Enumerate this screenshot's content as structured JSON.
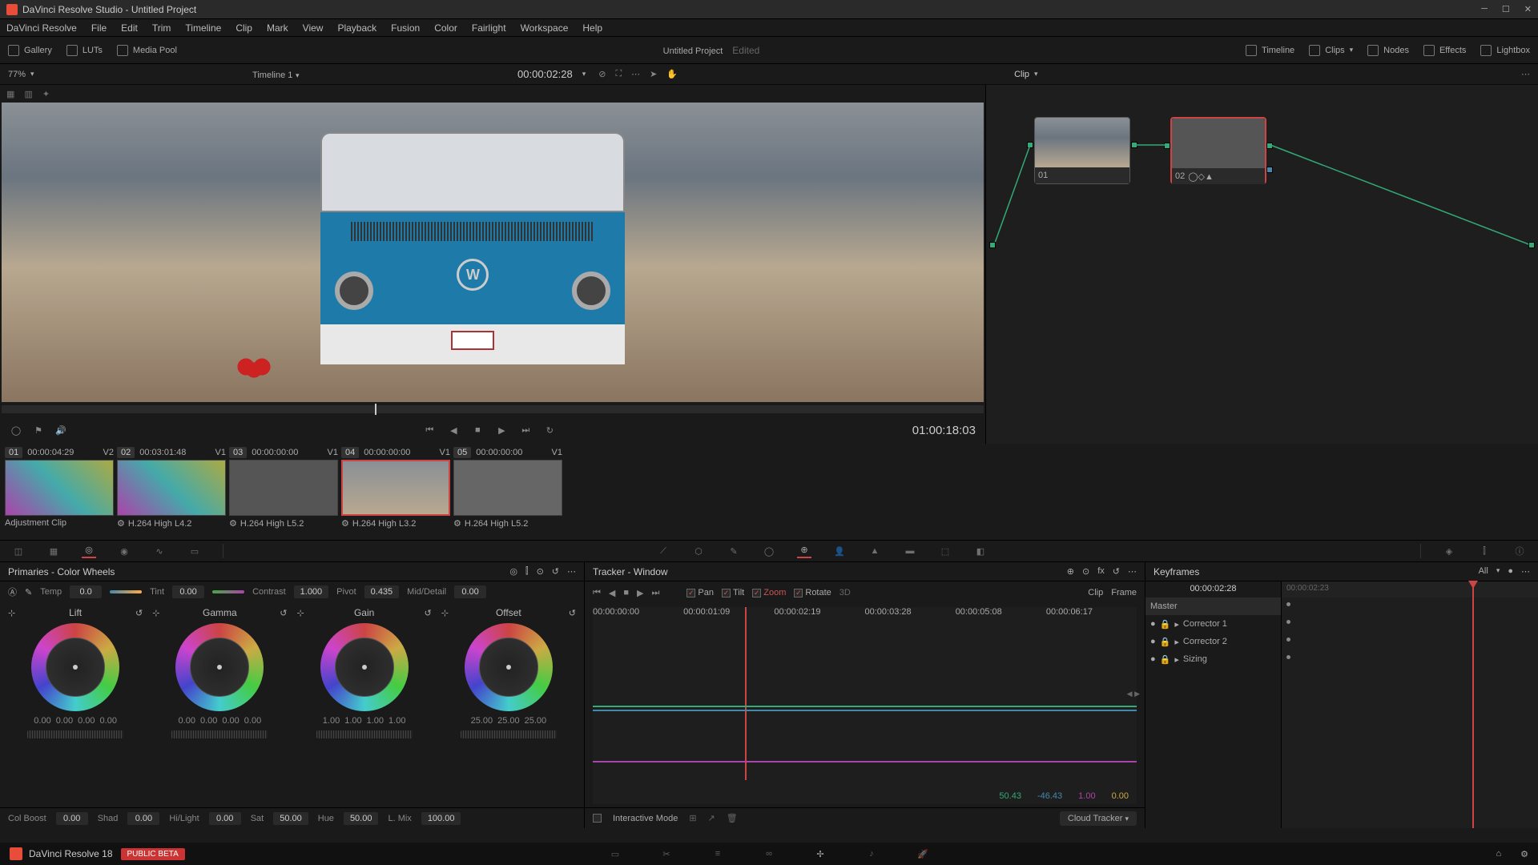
{
  "titlebar": {
    "title": "DaVinci Resolve Studio - Untitled Project"
  },
  "menubar": [
    "DaVinci Resolve",
    "File",
    "Edit",
    "Trim",
    "Timeline",
    "Clip",
    "Mark",
    "View",
    "Playback",
    "Fusion",
    "Color",
    "Fairlight",
    "Workspace",
    "Help"
  ],
  "workspace": {
    "left": [
      {
        "label": "Gallery"
      },
      {
        "label": "LUTs"
      },
      {
        "label": "Media Pool"
      }
    ],
    "project": "Untitled Project",
    "edited": "Edited",
    "right": [
      {
        "label": "Timeline"
      },
      {
        "label": "Clips"
      },
      {
        "label": "Nodes"
      },
      {
        "label": "Effects"
      },
      {
        "label": "Lightbox"
      }
    ]
  },
  "viewerbar": {
    "zoom": "77%",
    "timeline": "Timeline 1",
    "tc": "00:00:02:28",
    "mode": "Clip"
  },
  "transport": {
    "tc": "01:00:18:03"
  },
  "nodes": {
    "n1": {
      "label": "01"
    },
    "n2": {
      "label": "02"
    }
  },
  "clips": [
    {
      "num": "01",
      "tc": "00:00:04:29",
      "trk": "V2",
      "codec": "Adjustment Clip"
    },
    {
      "num": "02",
      "tc": "00:03:01:48",
      "trk": "V1",
      "codec": "H.264 High L4.2"
    },
    {
      "num": "03",
      "tc": "00:00:00:00",
      "trk": "V1",
      "codec": "H.264 High L5.2"
    },
    {
      "num": "04",
      "tc": "00:00:00:00",
      "trk": "V1",
      "codec": "H.264 High L3.2",
      "selected": true
    },
    {
      "num": "05",
      "tc": "00:00:00:00",
      "trk": "V1",
      "codec": "H.264 High L5.2"
    }
  ],
  "primaries": {
    "title": "Primaries - Color Wheels",
    "temp": {
      "label": "Temp",
      "val": "0.0"
    },
    "tint": {
      "label": "Tint",
      "val": "0.00"
    },
    "contrast": {
      "label": "Contrast",
      "val": "1.000"
    },
    "pivot": {
      "label": "Pivot",
      "val": "0.435"
    },
    "md": {
      "label": "Mid/Detail",
      "val": "0.00"
    },
    "wheels": [
      {
        "name": "Lift",
        "vals": [
          "0.00",
          "0.00",
          "0.00",
          "0.00"
        ]
      },
      {
        "name": "Gamma",
        "vals": [
          "0.00",
          "0.00",
          "0.00",
          "0.00"
        ]
      },
      {
        "name": "Gain",
        "vals": [
          "1.00",
          "1.00",
          "1.00",
          "1.00"
        ]
      },
      {
        "name": "Offset",
        "vals": [
          "25.00",
          "25.00",
          "25.00"
        ]
      }
    ],
    "row2": {
      "colboost": {
        "label": "Col Boost",
        "val": "0.00"
      },
      "shad": {
        "label": "Shad",
        "val": "0.00"
      },
      "hilight": {
        "label": "Hi/Light",
        "val": "0.00"
      },
      "sat": {
        "label": "Sat",
        "val": "50.00"
      },
      "hue": {
        "label": "Hue",
        "val": "50.00"
      },
      "lmix": {
        "label": "L. Mix",
        "val": "100.00"
      }
    }
  },
  "tracker": {
    "title": "Tracker - Window",
    "opts": {
      "pan": "Pan",
      "tilt": "Tilt",
      "zoom": "Zoom",
      "rotate": "Rotate",
      "threed": "3D"
    },
    "modes": {
      "clip": "Clip",
      "frame": "Frame"
    },
    "tcs": [
      "00:00:00:00",
      "00:00:01:09",
      "00:00:02:19",
      "00:00:03:28",
      "00:00:05:08",
      "00:00:06:17"
    ],
    "vals": {
      "a": "50.43",
      "b": "-46.43",
      "c": "1.00",
      "d": "0.00"
    },
    "interactive": "Interactive Mode",
    "cloud": "Cloud Tracker"
  },
  "keyframes": {
    "title": "Keyframes",
    "filter": "All",
    "tc": "00:00:02:28",
    "tc2": "00:00:02:23",
    "rows": [
      "Master",
      "Corrector 1",
      "Corrector 2",
      "Sizing"
    ]
  },
  "footer": {
    "ver": "DaVinci Resolve 18",
    "beta": "PUBLIC BETA"
  }
}
